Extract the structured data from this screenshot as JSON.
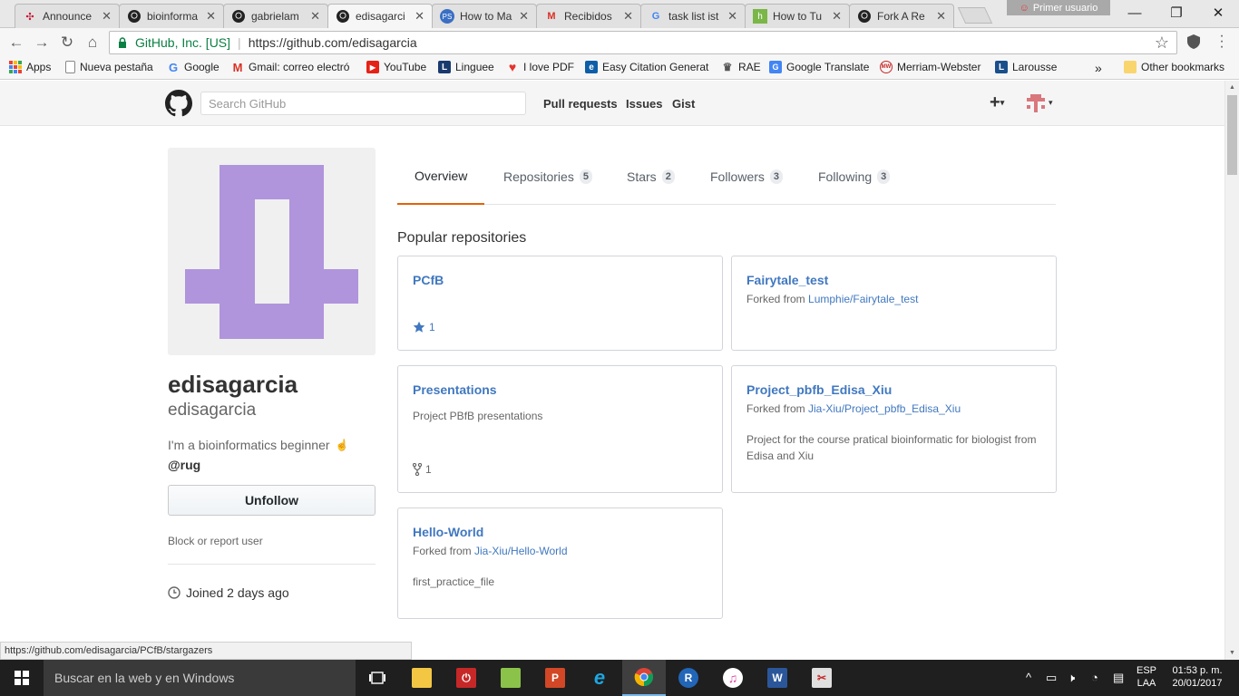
{
  "browser": {
    "tabs": [
      {
        "label": "Announce",
        "icon": "pdf-icon",
        "active": false
      },
      {
        "label": "bioinforma",
        "icon": "github-icon",
        "active": false
      },
      {
        "label": "gabrielam",
        "icon": "github-icon",
        "active": false
      },
      {
        "label": "edisagarci",
        "icon": "github-icon",
        "active": true
      },
      {
        "label": "How to Ma",
        "icon": "ps-icon",
        "active": false
      },
      {
        "label": "Recibidos",
        "icon": "gmail-icon",
        "active": false
      },
      {
        "label": "task list ist",
        "icon": "google-icon",
        "active": false
      },
      {
        "label": "How to Tu",
        "icon": "hubpages-icon",
        "active": false
      },
      {
        "label": "Fork A Re",
        "icon": "github-icon",
        "active": false
      }
    ],
    "profile_label": "Primer usuario",
    "secure_label": "GitHub, Inc. [US]",
    "url": "https://github.com/edisagarcia",
    "bookmarks": [
      "Apps",
      "Nueva pestaña",
      "Google",
      "Gmail: correo electró",
      "YouTube",
      "Linguee",
      "I love PDF",
      "Easy Citation Generat",
      "RAE",
      "Google Translate",
      "Merriam-Webster",
      "Larousse"
    ],
    "bookmarks_overflow": "»",
    "other_bookmarks": "Other bookmarks",
    "status_url": "https://github.com/edisagarcia/PCfB/stargazers"
  },
  "github": {
    "search_placeholder": "Search GitHub",
    "nav": [
      "Pull requests",
      "Issues",
      "Gist"
    ],
    "plus": "+"
  },
  "profile": {
    "fullname": "edisagarcia",
    "username": "edisagarcia",
    "bio": "I'm a bioinformatics beginner",
    "org": "@rug",
    "unfollow_label": "Unfollow",
    "block_label": "Block or report user",
    "joined": "Joined 2 days ago",
    "avatar_color": "#b094dc"
  },
  "tabs": [
    {
      "label": "Overview",
      "count": null,
      "active": true
    },
    {
      "label": "Repositories",
      "count": "5",
      "active": false
    },
    {
      "label": "Stars",
      "count": "2",
      "active": false
    },
    {
      "label": "Followers",
      "count": "3",
      "active": false
    },
    {
      "label": "Following",
      "count": "3",
      "active": false
    }
  ],
  "popular_title": "Popular repositories",
  "repos": [
    {
      "name": "PCfB",
      "forked_prefix": "",
      "forked_from": "",
      "description": "",
      "meta_icon": "star-icon",
      "meta": "1"
    },
    {
      "name": "Fairytale_test",
      "forked_prefix": "Forked from ",
      "forked_from": "Lumphie/Fairytale_test",
      "description": "",
      "meta_icon": "",
      "meta": ""
    },
    {
      "name": "Presentations",
      "forked_prefix": "",
      "forked_from": "",
      "description": "Project PBfB presentations",
      "meta_icon": "fork-icon",
      "meta": "1"
    },
    {
      "name": "Project_pbfb_Edisa_Xiu",
      "forked_prefix": "Forked from ",
      "forked_from": "Jia-Xiu/Project_pbfb_Edisa_Xiu",
      "description": "Project for the course pratical bioinformatic for biologist from Edisa and Xiu",
      "meta_icon": "",
      "meta": ""
    },
    {
      "name": "Hello-World",
      "forked_prefix": "Forked from ",
      "forked_from": "Jia-Xiu/Hello-World",
      "description": "first_practice_file",
      "meta_icon": "",
      "meta": ""
    }
  ],
  "taskbar": {
    "search_placeholder": "Buscar en la web y en Windows",
    "lang_top": "ESP",
    "lang_bottom": "LAA",
    "time": "01:53 p. m.",
    "date": "20/01/2017"
  }
}
